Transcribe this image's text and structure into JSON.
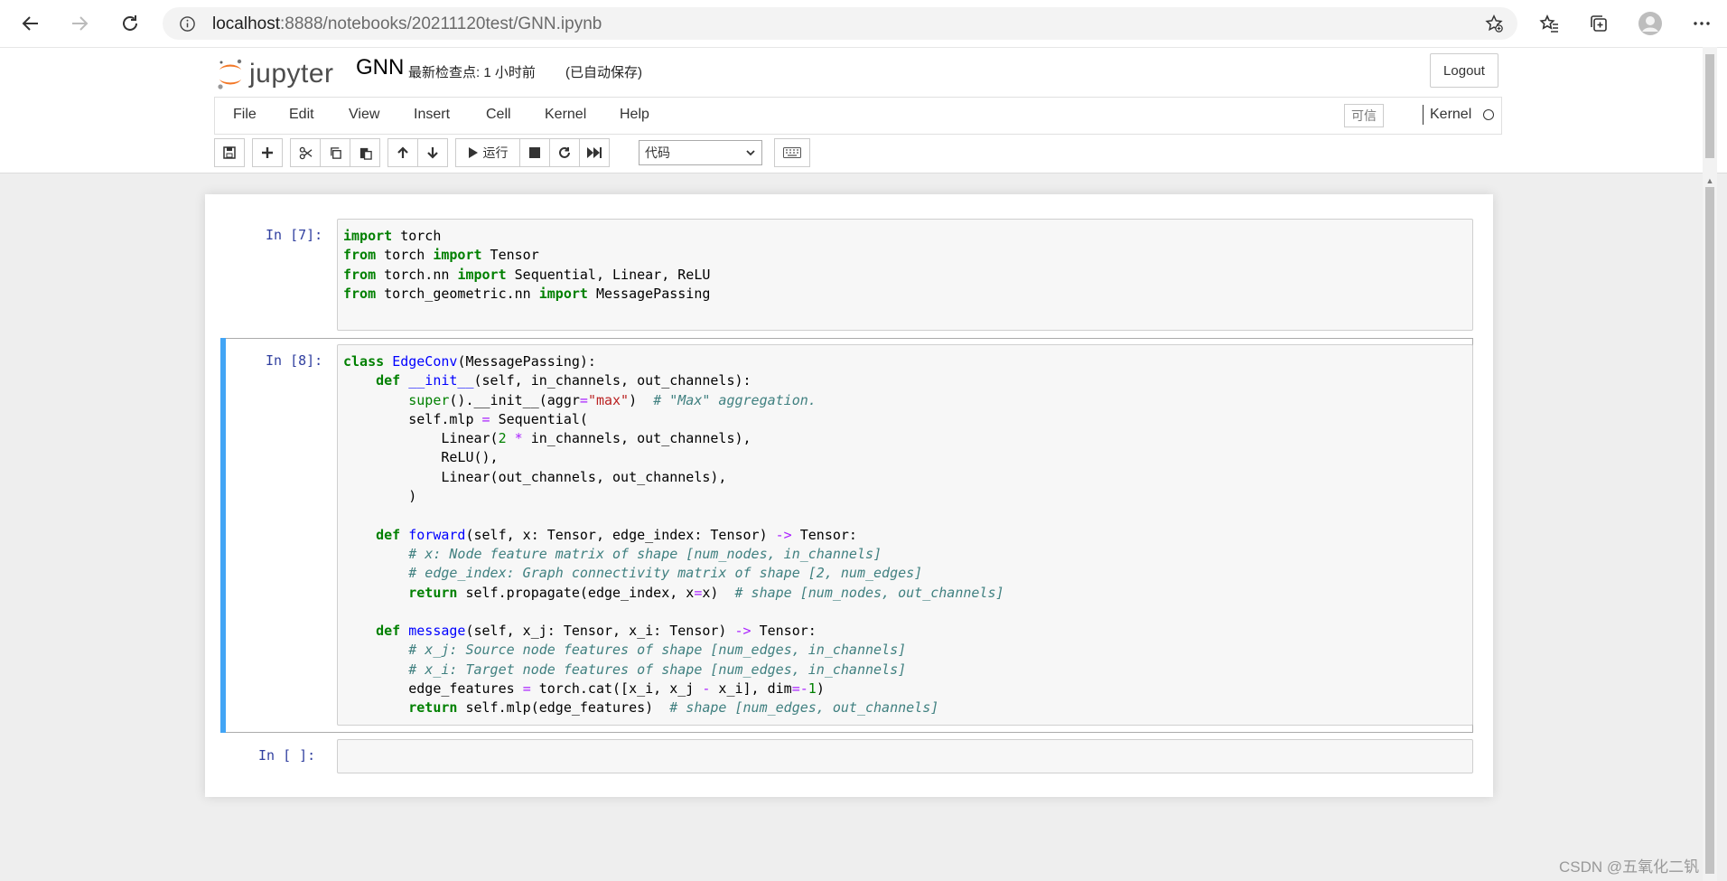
{
  "browser": {
    "url_host": "localhost",
    "url_rest": ":8888/notebooks/20211120test/GNN.ipynb"
  },
  "header": {
    "logo_text": "jupyter",
    "notebook_name": "GNN",
    "checkpoint_text": "最新检查点: 1 小时前",
    "autosave_text": "(已自动保存)",
    "logout_label": "Logout"
  },
  "menu": {
    "items": [
      "File",
      "Edit",
      "View",
      "Insert",
      "Cell",
      "Kernel",
      "Help"
    ],
    "trusted_label": "可信",
    "kernel_label": "Kernel"
  },
  "toolbar": {
    "run_label": "运行",
    "cell_type": "代码"
  },
  "cells": [
    {
      "prompt": "In [7]:",
      "code": "import torch\nfrom torch import Tensor\nfrom torch.nn import Sequential, Linear, ReLU\nfrom torch_geometric.nn import MessagePassing"
    },
    {
      "prompt": "In [8]:",
      "code": "class EdgeConv(MessagePassing):\n    def __init__(self, in_channels, out_channels):\n        super().__init__(aggr=\"max\")  # \"Max\" aggregation.\n        self.mlp = Sequential(\n            Linear(2 * in_channels, out_channels),\n            ReLU(),\n            Linear(out_channels, out_channels),\n        )\n\n    def forward(self, x: Tensor, edge_index: Tensor) -> Tensor:\n        # x: Node feature matrix of shape [num_nodes, in_channels]\n        # edge_index: Graph connectivity matrix of shape [2, num_edges]\n        return self.propagate(edge_index, x=x)  # shape [num_nodes, out_channels]\n\n    def message(self, x_j: Tensor, x_i: Tensor) -> Tensor:\n        # x_j: Source node features of shape [num_edges, in_channels]\n        # x_i: Target node features of shape [num_edges, in_channels]\n        edge_features = torch.cat([x_i, x_j - x_i], dim=-1)\n        return self.mlp(edge_features)  # shape [num_edges, out_channels]"
    },
    {
      "prompt": "In [ ]:",
      "code": ""
    }
  ],
  "watermark": "CSDN @五氧化二钒",
  "colors": {
    "keyword": "#008000",
    "comment": "#408080",
    "string": "#ba2121",
    "selected_bar": "#42a5f5",
    "prompt": "#303f9f"
  }
}
